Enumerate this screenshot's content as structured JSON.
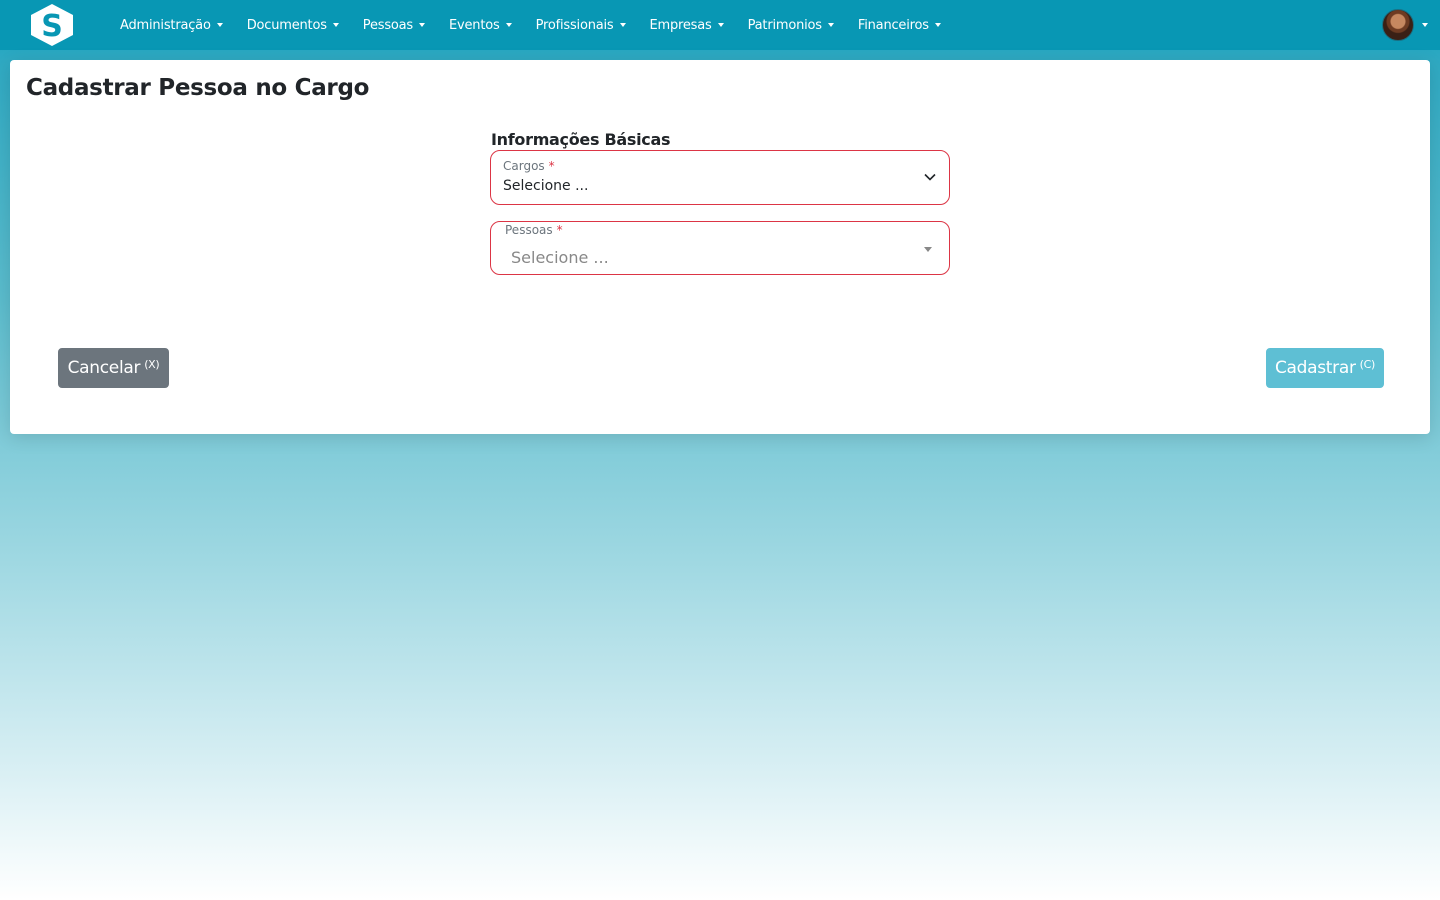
{
  "nav": {
    "logo_letter": "S",
    "items": [
      {
        "label": "Administração"
      },
      {
        "label": "Documentos"
      },
      {
        "label": "Pessoas"
      },
      {
        "label": "Eventos"
      },
      {
        "label": "Profissionais"
      },
      {
        "label": "Empresas"
      },
      {
        "label": "Patrimonios"
      },
      {
        "label": "Financeiros"
      }
    ]
  },
  "page": {
    "title": "Cadastrar Pessoa no Cargo"
  },
  "form": {
    "section_title": "Informações Básicas",
    "cargos": {
      "label": "Cargos",
      "required_mark": "*",
      "value": "Selecione ..."
    },
    "pessoas": {
      "label": "Pessoas",
      "required_mark": "*",
      "placeholder": "Selecione ..."
    }
  },
  "buttons": {
    "cancel": {
      "label": "Cancelar",
      "shortcut": "(X)"
    },
    "submit": {
      "label": "Cadastrar",
      "shortcut": "(C)"
    }
  },
  "colors": {
    "topbar": "#0897b4",
    "error_border": "#dc3545",
    "cancel_button": "#6c757d",
    "submit_button": "#5ebfd4"
  }
}
